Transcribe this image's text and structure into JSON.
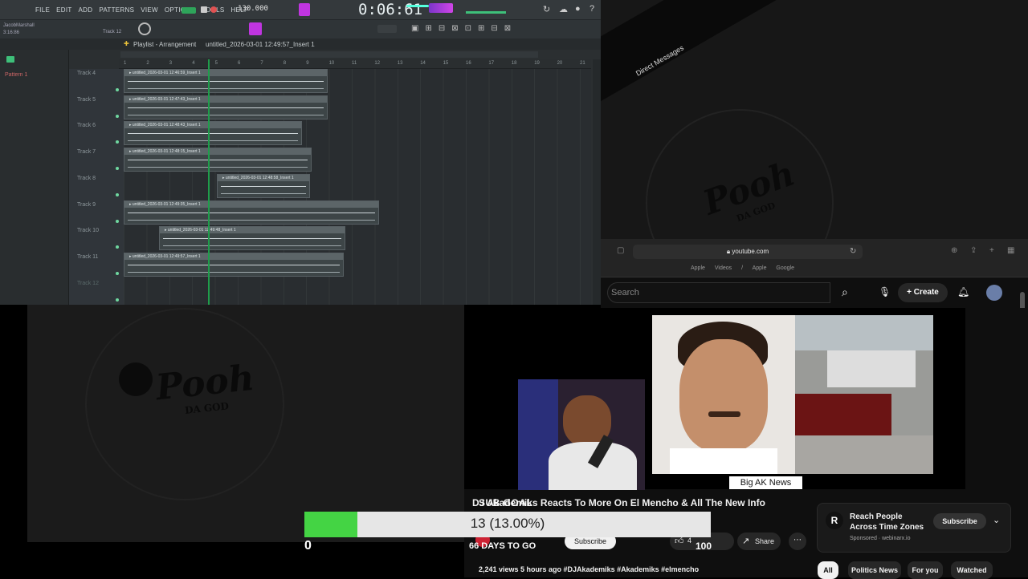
{
  "daw": {
    "menu": [
      "FILE",
      "EDIT",
      "ADD",
      "PATTERNS",
      "VIEW",
      "OPTIONS",
      "TOOLS",
      "HELP"
    ],
    "time_display": "0:06:61",
    "tempo": "130.000",
    "hint_name": "JacobMarshall",
    "hint_time": "3:16:86",
    "track_selector": "Track 12",
    "playlist_title": "Playlist - Arrangement",
    "playlist_file": "untitled_2026-03-01 12:49:57_Insert 1",
    "side_pattern": "Pattern 1",
    "tracks": [
      {
        "label": "Track 4",
        "clip": "untitled_2026-03-01 12:46:59_Insert 1"
      },
      {
        "label": "Track 5",
        "clip": "untitled_2026-03-01 12:47:43_Insert 1"
      },
      {
        "label": "Track 6",
        "clip": "untitled_2026-03-01 12:48:43_Insert 1"
      },
      {
        "label": "Track 7",
        "clip": "untitled_2026-03-01 12:48:15_Insert 1"
      },
      {
        "label": "Track 8",
        "clip": "untitled_2026-03-01 12:48:58_Insert 1"
      },
      {
        "label": "Track 9",
        "clip": "untitled_2026-03-01 12:49:35_Insert 1"
      },
      {
        "label": "Track 10",
        "clip": "untitled_2026-03-01 12:49:48_Insert 1"
      },
      {
        "label": "Track 11",
        "clip": "untitled_2026-03-01 12:49:57_Insert 1"
      },
      {
        "label": "Track 12",
        "clip": ""
      }
    ],
    "ruler": [
      "1",
      "2",
      "3",
      "4",
      "5",
      "6",
      "7",
      "8",
      "9",
      "10",
      "11",
      "12",
      "13",
      "14",
      "15",
      "16",
      "17",
      "18",
      "19",
      "20",
      "21"
    ]
  },
  "logos": {
    "top_text": "Pooh",
    "top_sub": "DA GOD",
    "bottom_text": "Pooh",
    "bottom_sub": "DA GOD"
  },
  "dm": {
    "label": "Direct Messages"
  },
  "browser": {
    "url": "youtube.com",
    "favorites": "Apple Videos / Apple Google"
  },
  "youtube": {
    "search_placeholder": "Search",
    "create_label": "Create",
    "overlay_caption": "Big AK News",
    "video_title": "DJ Akademiks Reacts To More On El Mencho & All The New Info",
    "subgoal_label": "SUB GOAL",
    "subscribe_label": "Subscribe",
    "like_count": "4",
    "share_label": "Share",
    "views_line": "2,241 views  5 hours ago  #DJAkademiks #Akademiks #elmencho",
    "ad_title": "Reach People Across Time Zones",
    "ad_sponsor": "Sponsored · webinarx.io",
    "ad_button": "Subscribe",
    "chips": [
      "All",
      "Politics News",
      "For you",
      "Watched"
    ]
  },
  "subgoal": {
    "current": 13,
    "goal_percent": 13.0,
    "progress_text": "13 (13.00%)",
    "start_label": "0",
    "end_label": "100",
    "days_text": "66 DAYS TO GO",
    "bar_fill": "#44d444"
  },
  "colors": {
    "daw_bg": "#2b2f31",
    "yt_bg": "#0f0f0f",
    "accent_purple": "#c035e0",
    "playhead": "#1f9d4b"
  }
}
